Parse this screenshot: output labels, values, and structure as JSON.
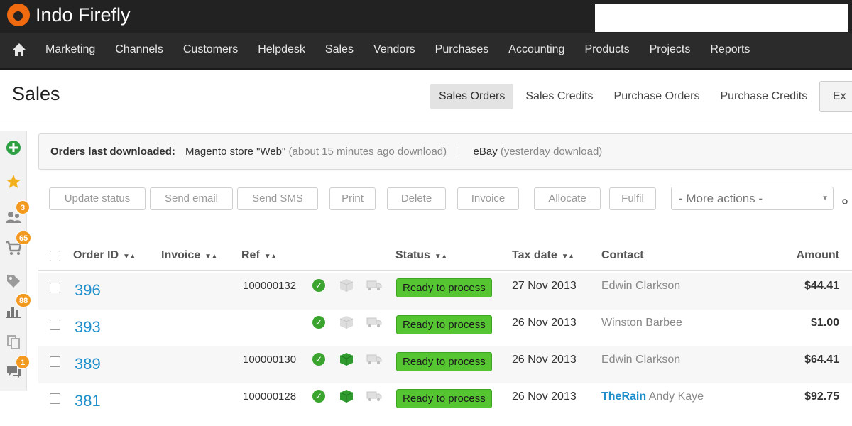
{
  "app": {
    "name": "Indo Firefly",
    "brand_color": "#f06a0f"
  },
  "nav": {
    "items": [
      {
        "label": "Marketing"
      },
      {
        "label": "Channels"
      },
      {
        "label": "Customers"
      },
      {
        "label": "Helpdesk"
      },
      {
        "label": "Sales"
      },
      {
        "label": "Vendors"
      },
      {
        "label": "Purchases"
      },
      {
        "label": "Accounting"
      },
      {
        "label": "Products"
      },
      {
        "label": "Projects"
      },
      {
        "label": "Reports"
      }
    ]
  },
  "page": {
    "title": "Sales"
  },
  "tabs": [
    {
      "label": "Sales Orders",
      "active": true
    },
    {
      "label": "Sales Credits"
    },
    {
      "label": "Purchase Orders"
    },
    {
      "label": "Purchase Credits"
    },
    {
      "label": "Ex"
    }
  ],
  "rail": {
    "badges": {
      "contacts": "3",
      "cart": "65",
      "reports": "88",
      "chat": "1"
    }
  },
  "info": {
    "label": "Orders last downloaded:",
    "store1": "Magento store \"Web\"",
    "store1_time": "(about 15 minutes ago download)",
    "store2": "eBay",
    "store2_time": "(yesterday download)"
  },
  "actions": {
    "update_status": "Update status",
    "send_email": "Send email",
    "send_sms": "Send SMS",
    "print": "Print",
    "delete": "Delete",
    "invoice": "Invoice",
    "allocate": "Allocate",
    "fulfil": "Fulfil",
    "more_actions": "- More actions -",
    "more_actions_selected": "- More actions -"
  },
  "table": {
    "columns": {
      "order_id": "Order ID",
      "invoice": "Invoice",
      "ref": "Ref",
      "status": "Status",
      "tax_date": "Tax date",
      "contact": "Contact",
      "amount": "Amount"
    },
    "rows": [
      {
        "order_id": "396",
        "ref": "100000132",
        "packed": false,
        "status": "Ready to process",
        "tax_date": "27 Nov 2013",
        "contact_company": "",
        "contact_name": "Edwin Clarkson",
        "amount": "$44.41"
      },
      {
        "order_id": "393",
        "ref": "",
        "packed": false,
        "status": "Ready to process",
        "tax_date": "26 Nov 2013",
        "contact_company": "",
        "contact_name": "Winston Barbee",
        "amount": "$1.00"
      },
      {
        "order_id": "389",
        "ref": "100000130",
        "packed": true,
        "status": "Ready to process",
        "tax_date": "26 Nov 2013",
        "contact_company": "",
        "contact_name": "Edwin Clarkson",
        "amount": "$64.41"
      },
      {
        "order_id": "381",
        "ref": "100000128",
        "packed": true,
        "status": "Ready to process",
        "tax_date": "26 Nov 2013",
        "contact_company": "TheRain",
        "contact_name": "Andy Kaye",
        "amount": "$92.75"
      }
    ],
    "status_color": "#55c532",
    "link_color": "#1f8fcb"
  }
}
